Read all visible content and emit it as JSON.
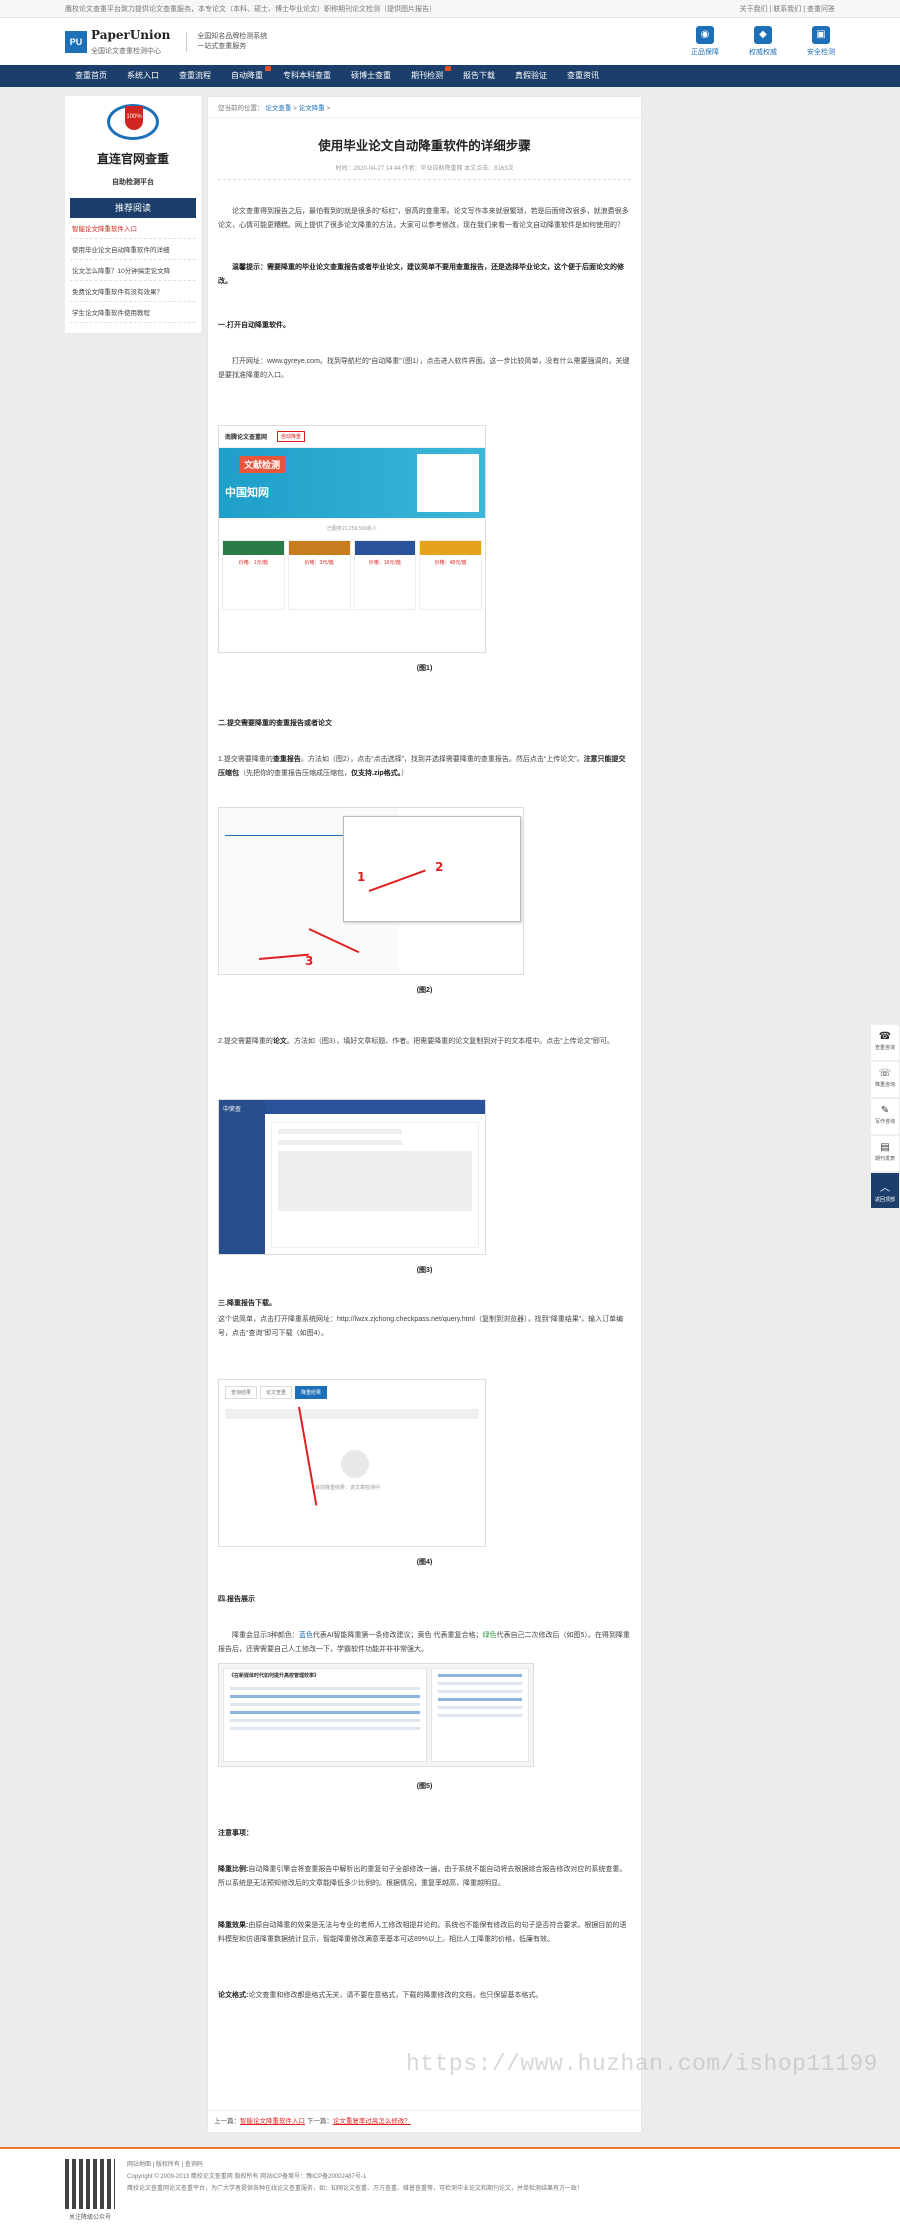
{
  "topbar": {
    "left": "鹰校论文查重平台致力提供论文查重服务，本专论文（本科、硕士、博士毕业论文）职称期刊论文检测（提供图片报告）",
    "right": "关于我们 | 联系我们 | 查重问答"
  },
  "header": {
    "logo_mark": "PU",
    "logo_name": "PaperUnion",
    "logo_sub": "全国论文查重检测中心",
    "slogan_1": "全国知名品牌检测系统",
    "slogan_2": "一站式查重服务",
    "icons": [
      {
        "name": "genuine-icon",
        "glyph": "◉",
        "label": "正品保障"
      },
      {
        "name": "authority-icon",
        "glyph": "◆",
        "label": "权威权威"
      },
      {
        "name": "security-icon",
        "glyph": "▣",
        "label": "安全检测"
      }
    ]
  },
  "nav": {
    "items": [
      {
        "label": "查重首页",
        "hot": false
      },
      {
        "label": "系统入口",
        "hot": false
      },
      {
        "label": "查重流程",
        "hot": false
      },
      {
        "label": "自动降重",
        "hot": true
      },
      {
        "label": "专科本科查重",
        "hot": false
      },
      {
        "label": "硕博士查重",
        "hot": false
      },
      {
        "label": "期刊检测",
        "hot": true
      },
      {
        "label": "报告下载",
        "hot": false
      },
      {
        "label": "真假验证",
        "hot": false
      },
      {
        "label": "查重资讯",
        "hot": false
      }
    ]
  },
  "sidebar": {
    "brand_title": "直连官网查重",
    "brand_sub": "自助检测平台",
    "badge_text": "100%",
    "rec_title": "推荐阅读",
    "rec_items": [
      {
        "label": "智能论文降重软件入口",
        "active": true
      },
      {
        "label": "使用毕业论文自动降重软件的详细",
        "active": false
      },
      {
        "label": "论文怎么降重？10分钟搞定论文降",
        "active": false
      },
      {
        "label": "免费论文降重软件有没有效果？",
        "active": false
      },
      {
        "label": "学生论文降重软件使用教程",
        "active": false
      }
    ]
  },
  "article": {
    "breadcrumb_prefix": "您当前的位置：",
    "breadcrumb": [
      "论文查重",
      "论文降重"
    ],
    "title": "使用毕业论文自动降重软件的详细步骤",
    "meta": "时间：2020-04-27 14:44 作者：毕业自助降重网 本文点击：8163次",
    "p1": "论文查重得到报告之后，最怕看到的就是很多的“标红”，很高的查重率。论文写作本来就很繁琐，若是后面修改很多，就浪费很多论文，心情可能更糟糕。网上提供了很多论文降重的方法，大家可以参考修改，现在我们来看一看论文自动降重软件是如何使用的？",
    "tip_label": "温馨提示：",
    "tip": "需要降重的毕业论文查重报告或者毕业论文，建议简单不要用查重报告，还是选择毕业论文，这个便于后面论文的修改。",
    "s1_title": "一.打开自动降重软件。",
    "s1_text": "打开网址：www.gyreye.com。找到导航栏的“自动降重”（图1），点击进入软件界面。这一步比较简单，没有什么需要强调的，关键是要找准降重的入口。",
    "fig1_cap": "(图1)",
    "s2_title": "二.提交需要降重的查重报告或者论文",
    "s2_text_a": "1.提交需要降重的",
    "s2_text_b": "查重报告",
    "s2_text_c": "。方法如（图2），点击“点击选择”，找到并选择需要降重的查重报告。然后点击“上传论文”。",
    "s2_note": "注意只能提交压缩包",
    "s2_note2": "（先把你的查重报告压缩成压缩包，",
    "s2_note3": "仅支持.zip格式。",
    "s2_note4": "）",
    "fig2_cap": "(图2)",
    "s2b_a": "2.提交需要降重的",
    "s2b_b": "论文",
    "s2b_c": "。方法如（图3），填好文章标题、作者。把需要降重的论文复制到对于的文本框中。点击“上传论文”即可。",
    "fig3_cap": "(图3)",
    "s3_title": "三.降重报告下载。",
    "s3_text": "这个说简单，点击打开降重系统网址：http://lwzx.zjchong.checkpass.net/query.html（复制到浏览器），找到“降重结果”，输入订单编号，点击“查询”即可下载（如图4）。",
    "fig4_cap": "(图4)",
    "s4_title": "四.报告展示",
    "s4_a": "降重会显示3种颜色：",
    "s4_blue": "蓝色",
    "s4_b": "代表AI智能降重第一条修改建议；黄色 代表重复合格；",
    "s4_green": "绿色",
    "s4_c": "代表自己二次修改后（如图5）。在得到降重报告后，还需需要自己人工修改一下，学霸软件功能并非非常强大。",
    "fig5_cap": "(图5)",
    "notes_title": "注意事项：",
    "n1_label": "降重比例:",
    "n1": "自动降重引擎会将查重报告中解析出的重复句子全部修改一遍，由于系统不能自动将去根据综合报告修改对应的系统查重。所以系统是无法预知修改后的文章能降低多少比例的。根据情况，重复率越高，降重越明显。",
    "n2_label": "降重效果:",
    "n2": "由原自动降重的效果是无法与专业的老师人工修改相提并论的。系统也不能保有修改后的句子是否符合要求。根据目前的语料模型和仿语降重数据统计显示，智能降重修改满意率基本可达89%以上。相比人工降重的价格，低廉有效。",
    "n3_label": "论文格式:",
    "n3": "论文查重和修改都是格式无关，请不要在意格式，下载的降重修改的文档，也只保留基本格式。",
    "prev_label": "上一篇：",
    "prev": "智能论文降重软件入口",
    "next_label": "下一篇：",
    "next": "论文重复率过高怎么修改？"
  },
  "figures": {
    "fig1": {
      "site_name": "南腾论文查重网",
      "nav_sel": "自动降重",
      "banner_1": "文献检测",
      "banner_2": "中国知网",
      "stats": "已服务21,259,569余人",
      "prices": [
        "价格：1元/篇",
        "价格：3元/篇",
        "价格：16元/篇",
        "价格：48元/篇"
      ]
    },
    "fig2": {
      "n1": "1",
      "n2": "2",
      "n3": "3"
    },
    "fig3": {
      "brand": "中荣查"
    },
    "fig4": {
      "tabs": [
        "查询结果",
        "论文查重",
        "降重结果"
      ],
      "empty": "目前降重结果：该文章检测中"
    },
    "fig5": {
      "title": "《在新媒体时代如何提升高校管理效率》"
    }
  },
  "footer": {
    "qr_caption": "关注降级公众号",
    "links": [
      "网站地图",
      "版权所有",
      "查询码"
    ],
    "copyright": "Copyright © 2009-2013 鹰校论文查重网 版权所有 网站ICP备案号：豫ICP备20002487号-1",
    "about": "鹰校论文查重网论文查重平台，为广大学者提供各种在线论文查重服务，如：知网论文查重、万方查重、维普查重等，可检测毕业论文和期刊论文，并单检测结果有方一致！"
  },
  "float_bar": [
    {
      "glyph": "☎",
      "label": "查重咨询"
    },
    {
      "glyph": "☏",
      "label": "降重咨询"
    },
    {
      "glyph": "✎",
      "label": "写作咨询"
    },
    {
      "glyph": "▤",
      "label": "期刊发表"
    },
    {
      "glyph": "︿",
      "label": "返回顶部"
    }
  ],
  "watermark": "https://www.huzhan.com/ishop11199"
}
